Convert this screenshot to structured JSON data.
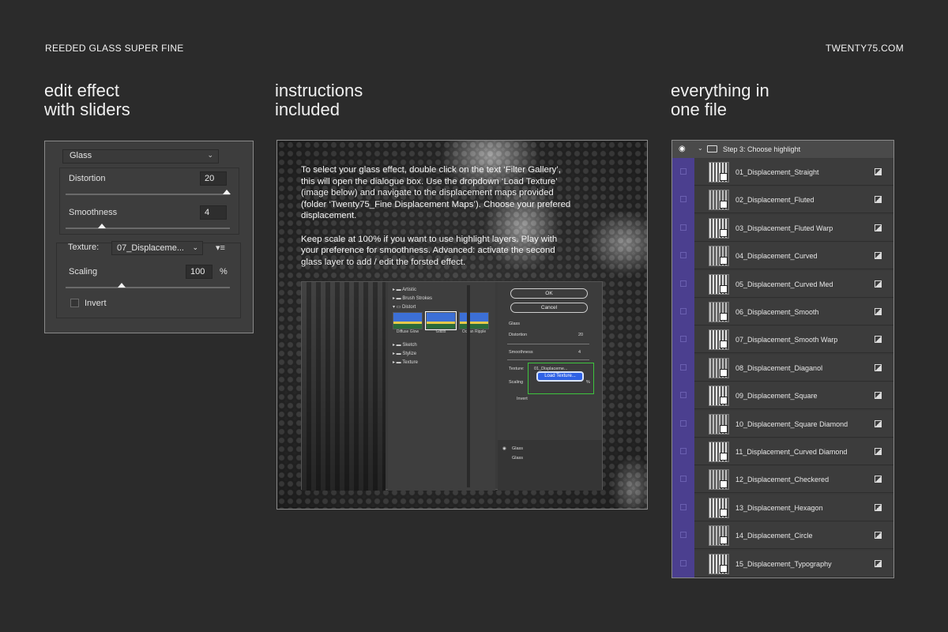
{
  "header": {
    "left": "REEDED GLASS SUPER FINE",
    "right": "TWENTY75.COM"
  },
  "headings": {
    "left": "edit effect\nwith sliders",
    "middle": "instructions\nincluded",
    "right": "everything in\none file"
  },
  "panel1": {
    "filter": "Glass",
    "distortion_label": "Distortion",
    "distortion_value": "20",
    "smoothness_label": "Smoothness",
    "smoothness_value": "4",
    "texture_label": "Texture:",
    "texture_value": "07_Displaceme...",
    "scaling_label": "Scaling",
    "scaling_value": "100",
    "scaling_unit": "%",
    "invert_label": "Invert"
  },
  "panel2": {
    "para1": "To select your glass effect, double click on the text ‘Filter Gallery’, this will open the dialogue box. Use the dropdown ‘Load Texture’ (image below) and navigate to the displacement maps provided (folder ‘Twenty75_Fine Displacement Maps’). Choose your prefered displacement.",
    "para2": "Keep scale at 100% if you want to use highlight layers. Play with your preference for smoothness. Advanced: activate the second glass layer to add / edit the forsted effect.",
    "dialog": {
      "tree": [
        "Artistic",
        "Brush Strokes",
        "Distort",
        "Sketch",
        "Stylize",
        "Texture"
      ],
      "thumbs": [
        "Diffuse Glow",
        "Glass",
        "Ocean Ripple"
      ],
      "ok": "OK",
      "cancel": "Cancel",
      "filter": "Glass",
      "distortion_label": "Distortion",
      "distortion_value": "20",
      "smoothness_label": "Smoothness",
      "smoothness_value": "4",
      "texture_label": "Texture:",
      "texture_value": "01_Displaceme...",
      "scaling_label": "Scaling",
      "scaling_unit": "%",
      "load_texture": "Load Texture...",
      "invert_label": "Invert",
      "layers": [
        "Glass",
        "Glass"
      ]
    }
  },
  "panel3": {
    "group_title": "Step 3: Choose highlight",
    "layers": [
      "01_Displacement_Straight",
      "02_Displacement_Fluted",
      "03_Displacement_Fluted Warp",
      "04_Displacement_Curved",
      "05_Displacement_Curved Med",
      "06_Displacement_Smooth",
      "07_Displacement_Smooth Warp",
      "08_Displacement_Diaganol",
      "09_Displacement_Square",
      "10_Displacement_Square Diamond",
      "11_Displacement_Curved Diamond",
      "12_Displacement_Checkered",
      "13_Displacement_Hexagon",
      "14_Displacement_Circle",
      "15_Displacement_Typography"
    ]
  },
  "colors": {
    "background": "#2b2b2b",
    "accent_purple": "#4b3f8f",
    "load_button": "#2f62e6",
    "highlight_green": "#3ec43e"
  }
}
